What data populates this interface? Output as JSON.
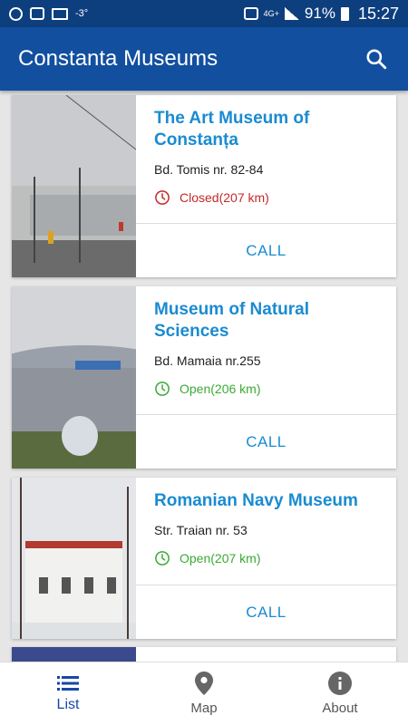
{
  "status_bar": {
    "temperature": "-3°",
    "network": "4G+",
    "battery": "91%",
    "time": "15:27",
    "icons": [
      "sync-icon",
      "shield-icon",
      "mail-icon",
      "nfc-icon",
      "signal-icon",
      "battery-icon"
    ]
  },
  "app_bar": {
    "title": "Constanta Museums",
    "search_icon": "search-icon"
  },
  "museums": [
    {
      "title": "The Art Museum of Constanța",
      "address": "Bd. Tomis nr. 82-84",
      "status": "Closed(207 km)",
      "status_type": "closed",
      "action": "CALL"
    },
    {
      "title": "Museum of Natural Sciences",
      "address": "Bd. Mamaia nr.255",
      "status": "Open(206 km)",
      "status_type": "open",
      "action": "CALL"
    },
    {
      "title": "Romanian Navy Museum",
      "address": "Str. Traian nr. 53",
      "status": "Open(207 km)",
      "status_type": "open",
      "action": "CALL"
    }
  ],
  "bottom_nav": [
    {
      "label": "List",
      "icon": "list-icon",
      "active": true
    },
    {
      "label": "Map",
      "icon": "map-pin-icon",
      "active": false
    },
    {
      "label": "About",
      "icon": "info-icon",
      "active": false
    }
  ],
  "colors": {
    "status_bar": "#0d3f7e",
    "app_bar": "#124f9f",
    "title_accent": "#1a8bd1",
    "closed": "#c62828",
    "open": "#3aaa35",
    "nav_active": "#1648a8"
  }
}
